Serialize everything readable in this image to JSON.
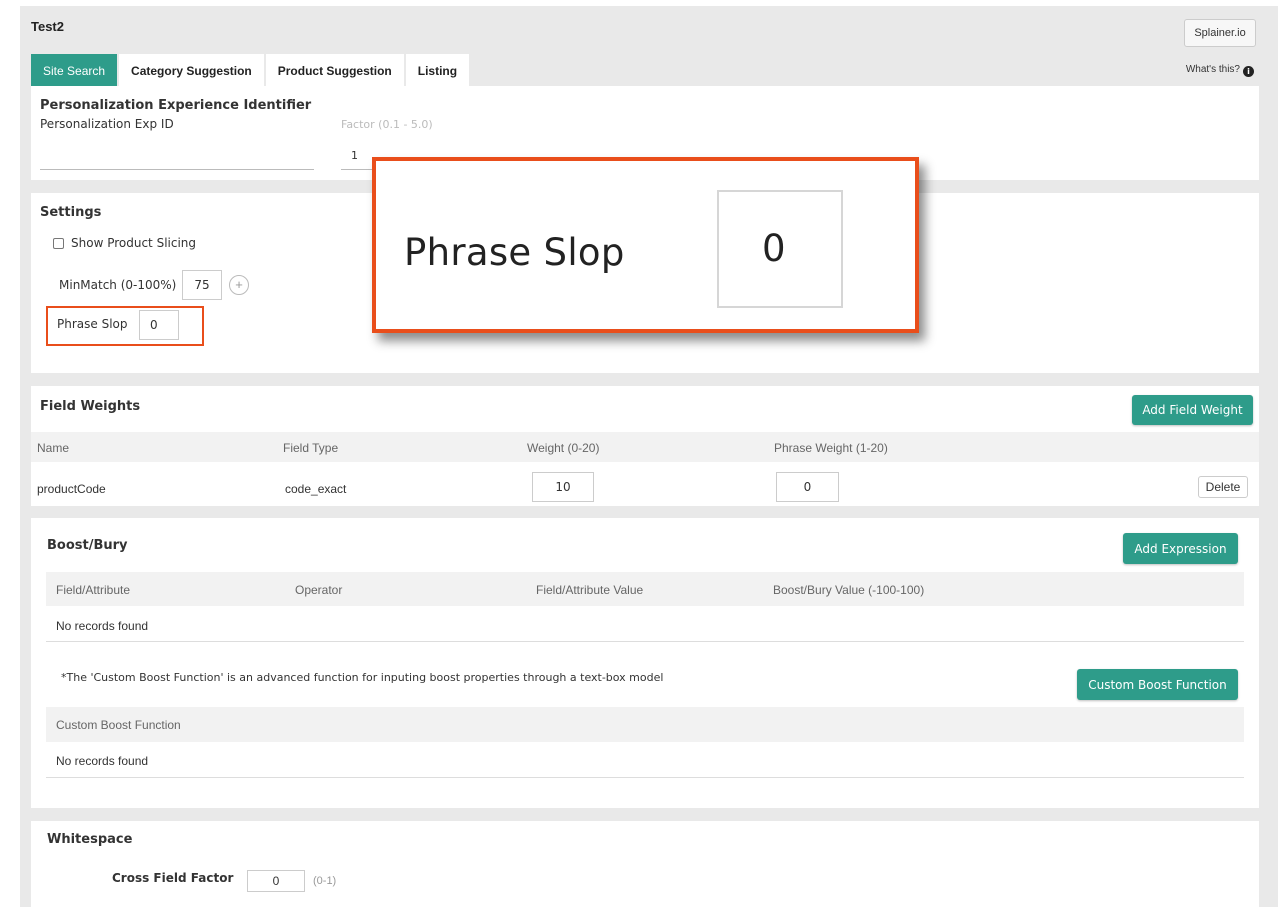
{
  "app": {
    "title": "Test2"
  },
  "header": {
    "splainer_label": "Splainer.io",
    "whats_this_label": "What's this?",
    "info_icon": "i"
  },
  "tabs": [
    {
      "label": "Site Search",
      "active": true
    },
    {
      "label": "Category Suggestion",
      "active": false
    },
    {
      "label": "Product Suggestion",
      "active": false
    },
    {
      "label": "Listing",
      "active": false
    }
  ],
  "personalization": {
    "title": "Personalization Experience Identifier",
    "exp_id_label": "Personalization Exp ID",
    "exp_id_value": "",
    "factor_label": "Factor (0.1 - 5.0)",
    "factor_value": "1"
  },
  "settings": {
    "title": "Settings",
    "show_slicing_label": "Show Product Slicing",
    "show_slicing_checked": false,
    "minmatch_label": "MinMatch (0-100%)",
    "minmatch_value": "75",
    "plus_icon": "+",
    "phrase_slop_label": "Phrase Slop",
    "phrase_slop_value": "0"
  },
  "zoom_callout": {
    "label": "Phrase Slop",
    "value": "0"
  },
  "field_weights": {
    "title": "Field Weights",
    "add_label": "Add Field Weight",
    "columns": [
      "Name",
      "Field Type",
      "Weight (0-20)",
      "Phrase Weight (1-20)"
    ],
    "rows": [
      {
        "name": "productCode",
        "field_type": "code_exact",
        "weight": "10",
        "phrase_weight": "0",
        "delete_label": "Delete"
      }
    ]
  },
  "boost_bury": {
    "title": "Boost/Bury",
    "add_label": "Add Expression",
    "columns": [
      "Field/Attribute",
      "Operator",
      "Field/Attribute Value",
      "Boost/Bury Value (-100-100)"
    ],
    "empty_text": "No records found",
    "custom_note": "*The 'Custom Boost Function' is an advanced function for inputing boost properties through a text-box model",
    "custom_button_label": "Custom Boost Function",
    "custom_column": "Custom Boost Function",
    "custom_empty_text": "No records found"
  },
  "whitespace": {
    "title": "Whitespace",
    "cross_field_label": "Cross Field Factor",
    "cross_field_value": "0",
    "cross_field_range": "(0-1)"
  },
  "colors": {
    "accent": "#2e9c8a",
    "highlight": "#e94e1b",
    "background": "#e9e9e9"
  }
}
